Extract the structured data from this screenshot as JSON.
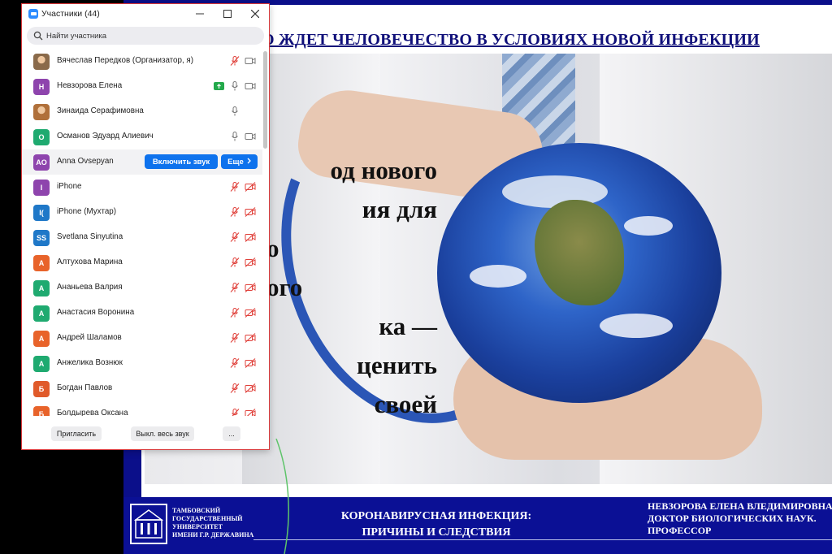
{
  "slide": {
    "title": "О ЖДЕТ ЧЕЛОВЕЧЕСТВО В УСЛОВИЯХ НОВОЙ ИНФЕКЦИИ",
    "body_lines": [
      "од  нового",
      "ия    для",
      "о",
      "ого",
      "ка      —",
      "ценить",
      "своей"
    ],
    "university": [
      "ТАМБОВСКИЙ",
      "ГОСУДАРСТВЕННЫЙ",
      "УНИВЕРСИТЕТ",
      "ИМЕНИ Г.Р. ДЕРЖАВИНА"
    ],
    "topic": [
      "КОРОНАВИРУСНАЯ ИНФЕКЦИЯ:",
      "ПРИЧИНЫ И СЛЕДСТВИЯ"
    ],
    "author": [
      "НЕВЗОРОВА ЕЛЕНА ВЛЕДИМИРОВНА",
      "ДОКТОР БИОЛОГИЧЕСКИХ НАУК.",
      "ПРОФЕССОР"
    ],
    "colors": {
      "navy": "#0b1095",
      "title": "#10107a"
    }
  },
  "panel": {
    "title": "Участники (44)",
    "search_placeholder": "Найти участника",
    "unmute_label": "Включить звук",
    "more_label": "Еще",
    "bottom": {
      "invite": "Пригласить",
      "mute_all": "Выкл. весь звук",
      "more": "..."
    },
    "colors": {
      "accent": "#0e72ed",
      "muted": "#e0403a"
    },
    "participants": [
      {
        "name": "Вячеслав Передков (Организатор, я)",
        "initials": "",
        "color": "#8a6a4a",
        "photo": true,
        "mic": "muted",
        "video": "on"
      },
      {
        "name": "Невзорова Елена",
        "initials": "Н",
        "color": "#8e44ad",
        "share": true,
        "mic": "on",
        "video": "on"
      },
      {
        "name": "Зинаида Серафимовна",
        "initials": "",
        "color": "#b0703a",
        "photo": true,
        "mic": "on",
        "video": "none"
      },
      {
        "name": "Османов Эдуард Алиевич",
        "initials": "О",
        "color": "#1faa70",
        "mic": "on",
        "video": "on"
      },
      {
        "name": "Anna Ovsepyan",
        "initials": "AO",
        "color": "#8e44ad",
        "highlight": true
      },
      {
        "name": "iPhone",
        "initials": "I",
        "color": "#8e44ad",
        "mic": "muted",
        "video": "off"
      },
      {
        "name": "iPhone (Мухтар)",
        "initials": "I(",
        "color": "#1f78c8",
        "mic": "muted",
        "video": "off"
      },
      {
        "name": "Svetlana Sinyutina",
        "initials": "SS",
        "color": "#1f78c8",
        "mic": "muted",
        "video": "off"
      },
      {
        "name": "Алтухова Марина",
        "initials": "А",
        "color": "#e8632a",
        "mic": "muted",
        "video": "off"
      },
      {
        "name": "Ананьева Валрия",
        "initials": "А",
        "color": "#1faa70",
        "mic": "muted",
        "video": "off"
      },
      {
        "name": "Анастасия Воронина",
        "initials": "А",
        "color": "#1faa70",
        "mic": "muted",
        "video": "off"
      },
      {
        "name": "Андрей Шаламов",
        "initials": "А",
        "color": "#e8632a",
        "mic": "muted",
        "video": "off"
      },
      {
        "name": "Анжелика Вознюк",
        "initials": "А",
        "color": "#1faa70",
        "mic": "muted",
        "video": "off"
      },
      {
        "name": "Богдан Павлов",
        "initials": "Б",
        "color": "#e05a2a",
        "mic": "muted",
        "video": "off"
      },
      {
        "name": "Болдырева Оксана",
        "initials": "Б",
        "color": "#e8632a",
        "mic": "muted",
        "video": "off"
      }
    ]
  }
}
